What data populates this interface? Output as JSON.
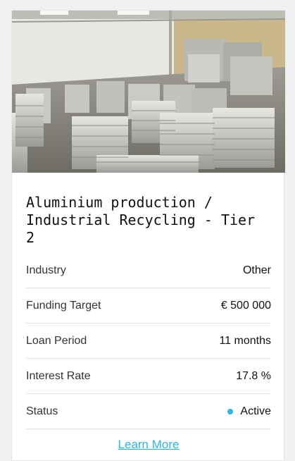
{
  "card": {
    "title": "Aluminium production / Industrial Recycling - Tier 2",
    "details": [
      {
        "label": "Industry",
        "value": "Other"
      },
      {
        "label": "Funding Target",
        "value": "€ 500 000"
      },
      {
        "label": "Loan Period",
        "value": "11 months"
      },
      {
        "label": "Interest Rate",
        "value": "17.8 %"
      },
      {
        "label": "Status",
        "value": "Active"
      }
    ],
    "status_color": "#29b6e6",
    "link_label": "Learn More",
    "link_color": "#29b6e6"
  }
}
